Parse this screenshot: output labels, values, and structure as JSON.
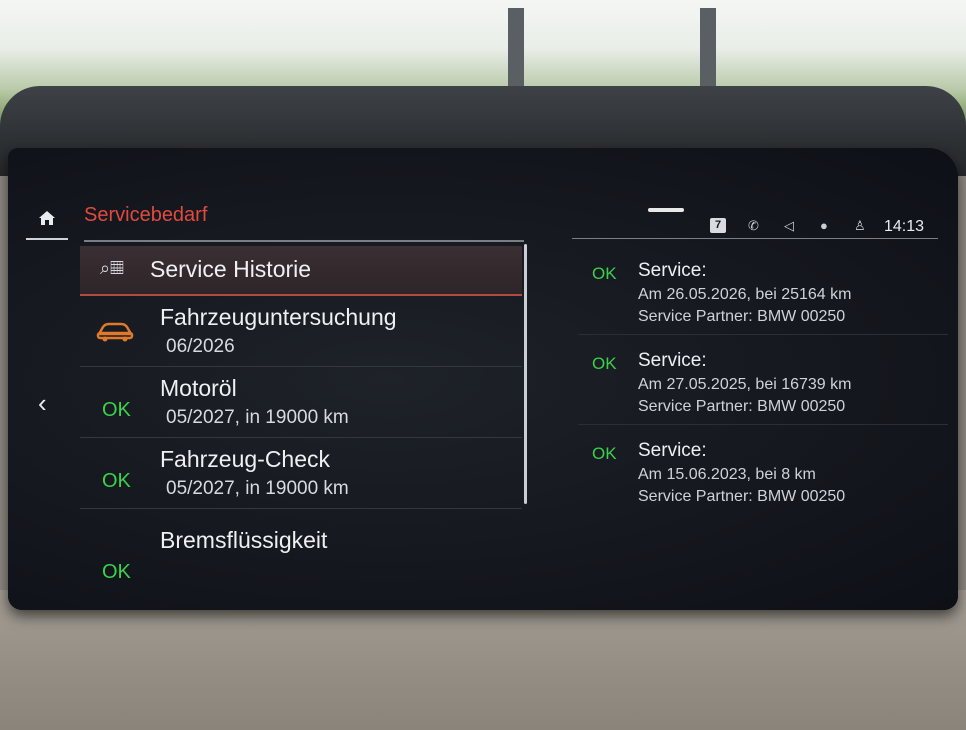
{
  "header": {
    "title": "Servicebedarf",
    "time": "14:13",
    "badge": "7"
  },
  "icons": {
    "home": "home-icon",
    "back": "chevron-left-icon",
    "phone": "phone-icon",
    "volume": "speaker-icon",
    "mic": "microphone-icon",
    "profile": "profile-icon",
    "car": "car-icon",
    "service_history": "service-history-icon"
  },
  "colors": {
    "accent": "#e04a3f",
    "ok": "#39d24a",
    "car_warning": "#e07a2a"
  },
  "list": {
    "header_label": "Service Historie",
    "items": [
      {
        "status": "",
        "title": "Fahrzeuguntersuchung",
        "subtitle": "06/2026"
      },
      {
        "status": "OK",
        "title": "Motoröl",
        "subtitle": "05/2027, in 19000 km"
      },
      {
        "status": "OK",
        "title": "Fahrzeug-Check",
        "subtitle": "05/2027, in 19000 km"
      },
      {
        "status": "OK",
        "title": "Bremsflüssigkeit",
        "subtitle": ""
      }
    ]
  },
  "history": [
    {
      "status": "OK",
      "title": "Service:",
      "line1": "Am 26.05.2026, bei 25164 km",
      "line2": "Service Partner: BMW 00250"
    },
    {
      "status": "OK",
      "title": "Service:",
      "line1": "Am 27.05.2025, bei 16739 km",
      "line2": "Service Partner: BMW 00250"
    },
    {
      "status": "OK",
      "title": "Service:",
      "line1": "Am 15.06.2023, bei 8 km",
      "line2": "Service Partner: BMW 00250"
    }
  ]
}
